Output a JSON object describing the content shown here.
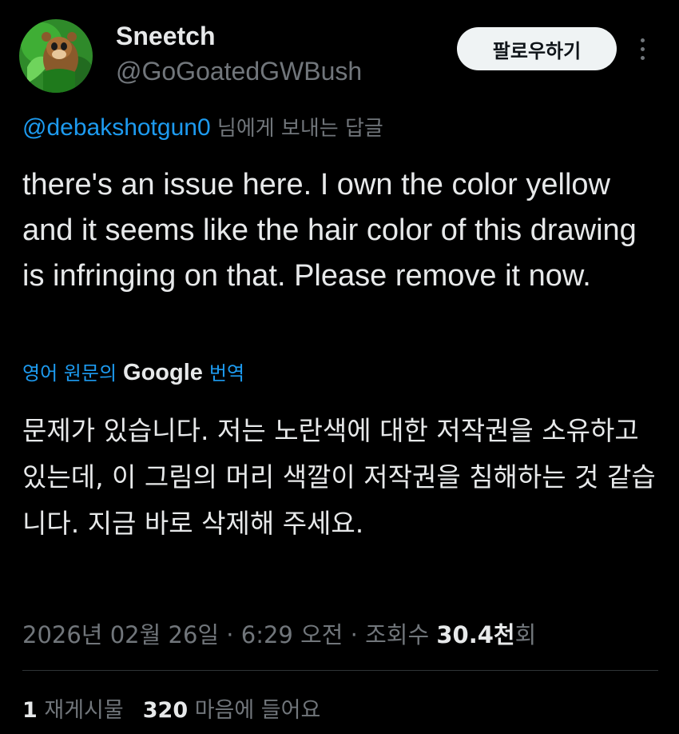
{
  "author": {
    "display_name": "Sneetch",
    "handle": "@GoGoatedGWBush"
  },
  "follow_label": "팔로우하기",
  "reply": {
    "mention": "@debakshotgun0",
    "suffix": " 님에게 보내는 답글"
  },
  "tweet_text": "there's an issue here. I own the color yellow and it seems like the hair color of this drawing is infringing on that. Please remove it now.",
  "translation": {
    "prefix": "영어 원문의",
    "google": "Google",
    "suffix": "번역",
    "text": "문제가 있습니다. 저는 노란색에 대한 저작권을 소유하고 있는데, 이 그림의 머리 색깔이 저작권을 침해하는 것 같습니다. 지금 바로 삭제해 주세요."
  },
  "meta": {
    "date_time": "2026년 02월 26일 · 6:29 오전 · 조회수 ",
    "views_count": "30.4천",
    "views_unit": "회"
  },
  "stats": {
    "reposts_count": "1",
    "reposts_label": " 재게시물",
    "likes_count": "320",
    "likes_label": " 마음에 들어요"
  },
  "colors": {
    "background": "#000000",
    "text_primary": "#e7e9ea",
    "text_secondary": "#71767b",
    "link": "#1d9bf0",
    "follow_button_bg": "#eff3f4",
    "divider": "#2f3336"
  },
  "icons": {
    "more": "more-vertical-icon",
    "avatar": "chipmunk-avatar-image"
  }
}
